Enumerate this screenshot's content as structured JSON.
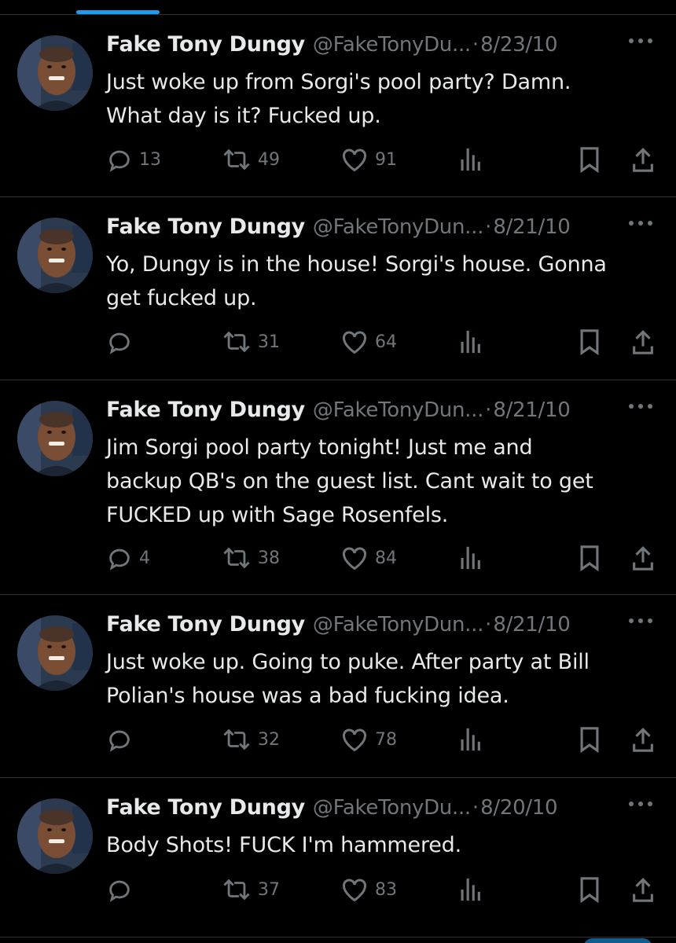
{
  "theme": {
    "background": "#000000",
    "text": "#e7e9ea",
    "muted": "#71767b",
    "accent": "#1d9bf0",
    "divider": "#2f3336"
  },
  "tweets": [
    {
      "name": "Fake Tony Dungy",
      "handle": "@FakeTonyDu...",
      "separator": "·",
      "date": "8/23/10",
      "text": "Just woke up from Sorgi's pool party? Damn.\nWhat day is it? Fucked up.",
      "replies": "13",
      "retweets": "49",
      "likes": "91",
      "icons": [
        "reply-icon",
        "retweet-icon",
        "like-icon",
        "views-icon",
        "bookmark-icon",
        "share-icon"
      ]
    },
    {
      "name": "Fake Tony Dungy",
      "handle": "@FakeTonyDun...",
      "separator": "·",
      "date": "8/21/10",
      "text": "Yo, Dungy is in the house! Sorgi's house. Gonna\nget fucked up.",
      "replies": "",
      "retweets": "31",
      "likes": "64",
      "icons": [
        "reply-icon",
        "retweet-icon",
        "like-icon",
        "views-icon",
        "bookmark-icon",
        "share-icon"
      ]
    },
    {
      "name": "Fake Tony Dungy",
      "handle": "@FakeTonyDun...",
      "separator": "·",
      "date": "8/21/10",
      "text": "Jim Sorgi pool party tonight! Just me and\nbackup QB's on the guest list. Cant wait to get\nFUCKED up with Sage Rosenfels.",
      "replies": "4",
      "retweets": "38",
      "likes": "84",
      "icons": [
        "reply-icon",
        "retweet-icon",
        "like-icon",
        "views-icon",
        "bookmark-icon",
        "share-icon"
      ]
    },
    {
      "name": "Fake Tony Dungy",
      "handle": "@FakeTonyDun...",
      "separator": "·",
      "date": "8/21/10",
      "text": "Just woke up. Going to puke. After party at Bill\nPolian's house was a bad fucking idea.",
      "replies": "",
      "retweets": "32",
      "likes": "78",
      "icons": [
        "reply-icon",
        "retweet-icon",
        "like-icon",
        "views-icon",
        "bookmark-icon",
        "share-icon"
      ]
    },
    {
      "name": "Fake Tony Dungy",
      "handle": "@FakeTonyDu...",
      "separator": "·",
      "date": "8/20/10",
      "text": "Body Shots! FUCK I'm hammered.",
      "replies": "",
      "retweets": "37",
      "likes": "83",
      "icons": [
        "reply-icon",
        "retweet-icon",
        "like-icon",
        "views-icon",
        "bookmark-icon",
        "share-icon"
      ]
    }
  ]
}
